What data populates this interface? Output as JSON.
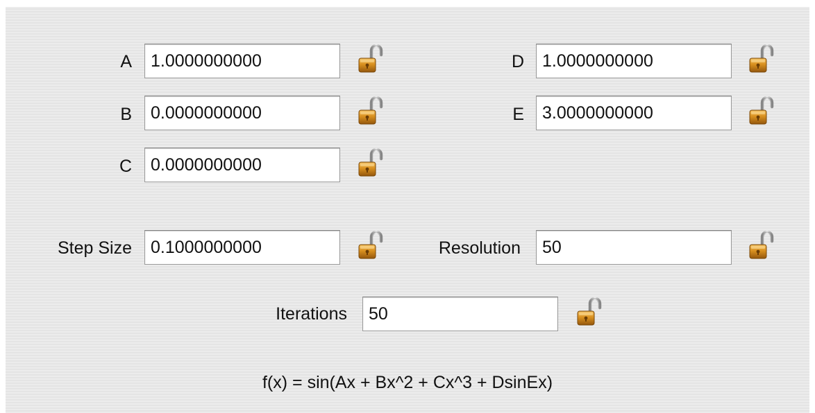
{
  "params": {
    "a": {
      "label": "A",
      "value": "1.0000000000"
    },
    "b": {
      "label": "B",
      "value": "0.0000000000"
    },
    "c": {
      "label": "C",
      "value": "0.0000000000"
    },
    "d": {
      "label": "D",
      "value": "1.0000000000"
    },
    "e": {
      "label": "E",
      "value": "3.0000000000"
    }
  },
  "step_size": {
    "label": "Step Size",
    "value": "0.1000000000"
  },
  "resolution": {
    "label": "Resolution",
    "value": "50"
  },
  "iterations": {
    "label": "Iterations",
    "value": "50"
  },
  "formula": "f(x) = sin(Ax + Bx^2 + Cx^3 + DsinEx)",
  "colors": {
    "lock_body": "#d28a1e",
    "lock_shackle": "#a8a8a8"
  },
  "icons": {
    "lock": "unlocked-padlock-icon"
  }
}
